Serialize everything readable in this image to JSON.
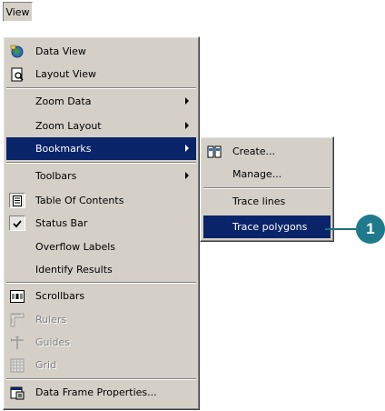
{
  "menubar": {
    "view_label": "View"
  },
  "view_menu": {
    "items": [
      {
        "label": "Data View",
        "icon": "data-view-icon"
      },
      {
        "label": "Layout View",
        "icon": "layout-view-icon"
      },
      {
        "label": "Zoom Data",
        "submenu": true
      },
      {
        "label": "Zoom Layout",
        "submenu": true
      },
      {
        "label": "Bookmarks",
        "submenu": true,
        "highlighted": true
      },
      {
        "label": "Toolbars",
        "submenu": true
      },
      {
        "label": "Table Of Contents",
        "icon": "table-of-contents-icon"
      },
      {
        "label": "Status Bar",
        "icon": "checkmark-icon",
        "checked": true
      },
      {
        "label": "Overflow Labels"
      },
      {
        "label": "Identify Results"
      },
      {
        "label": "Scrollbars",
        "icon": "scrollbars-icon"
      },
      {
        "label": "Rulers",
        "icon": "rulers-icon",
        "disabled": true
      },
      {
        "label": "Guides",
        "icon": "guides-icon",
        "disabled": true
      },
      {
        "label": "Grid",
        "icon": "grid-icon",
        "disabled": true
      },
      {
        "label": "Data Frame Properties...",
        "icon": "properties-icon"
      }
    ]
  },
  "bookmarks_menu": {
    "items": [
      {
        "label": "Create...",
        "icon": "create-bookmark-icon"
      },
      {
        "label": "Manage..."
      },
      {
        "label": "Trace lines"
      },
      {
        "label": "Trace polygons",
        "highlighted": true
      }
    ]
  },
  "callout": {
    "number": "1"
  },
  "colors": {
    "menu_bg": "#d4d0c8",
    "highlight": "#0a246a",
    "callout": "#1f7a8c"
  }
}
